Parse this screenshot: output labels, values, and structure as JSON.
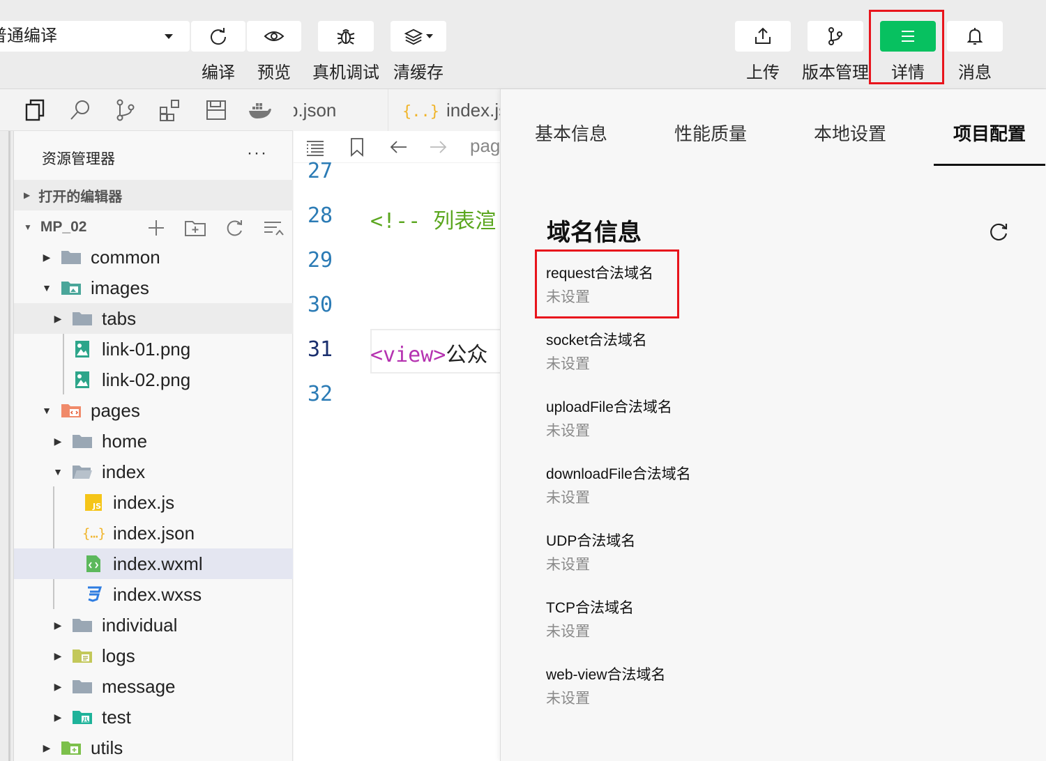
{
  "toolbar": {
    "compile_mode": "普通编译",
    "buttons": {
      "compile": "编译",
      "preview": "预览",
      "remote_debug": "真机调试",
      "clear_cache": "清缓存",
      "upload": "上传",
      "version": "版本管理",
      "details": "详情",
      "messages": "消息"
    }
  },
  "sidebar": {
    "title": "资源管理器",
    "more": "···",
    "open_editors": "打开的编辑器",
    "project": "MP_02",
    "tree": [
      "common",
      "images",
      "tabs",
      "link-01.png",
      "link-02.png",
      "pages",
      "home",
      "index",
      "index.js",
      "index.json",
      "index.wxml",
      "index.wxss",
      "individual",
      "logs",
      "message",
      "test",
      "utils"
    ]
  },
  "editor": {
    "tabs": [
      "p.json",
      "index.js"
    ],
    "breadcrumb": "pag",
    "lines": [
      {
        "n": "27",
        "text": ""
      },
      {
        "n": "28",
        "text": "<!-- 列表渲"
      },
      {
        "n": "29",
        "text": ""
      },
      {
        "n": "30",
        "text": ""
      },
      {
        "n": "31",
        "tag": "<view>",
        "text": "公众"
      },
      {
        "n": "32",
        "text": ""
      }
    ]
  },
  "panel": {
    "tabs": [
      "基本信息",
      "性能质量",
      "本地设置",
      "项目配置"
    ],
    "active_tab": "项目配置",
    "section_title": "域名信息",
    "domains": [
      {
        "label": "request合法域名",
        "value": "未设置"
      },
      {
        "label": "socket合法域名",
        "value": "未设置"
      },
      {
        "label": "uploadFile合法域名",
        "value": "未设置"
      },
      {
        "label": "downloadFile合法域名",
        "value": "未设置"
      },
      {
        "label": "UDP合法域名",
        "value": "未设置"
      },
      {
        "label": "TCP合法域名",
        "value": "未设置"
      },
      {
        "label": "web-view合法域名",
        "value": "未设置"
      }
    ]
  },
  "colors": {
    "accent": "#07c160",
    "highlight": "#e8141c",
    "line_number": "#2b7bb5",
    "comment": "#5aa61e",
    "tag": "#b532b0"
  }
}
